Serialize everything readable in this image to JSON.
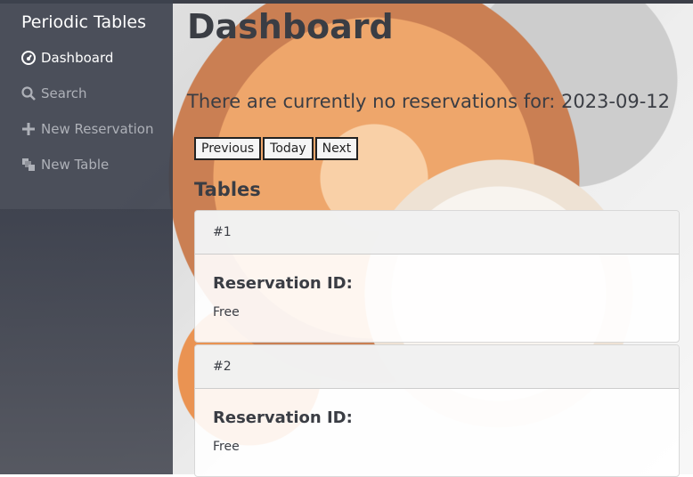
{
  "sidebar": {
    "brand": "Periodic Tables",
    "items": [
      {
        "label": "Dashboard",
        "icon": "dashboard-icon"
      },
      {
        "label": "Search",
        "icon": "search-icon"
      },
      {
        "label": "New Reservation",
        "icon": "plus-icon"
      },
      {
        "label": "New Table",
        "icon": "layers-icon"
      }
    ]
  },
  "main": {
    "title": "Dashboard",
    "reservations_message": "There are currently no reservations for: 2023-09-12",
    "date_controls": {
      "previous": "Previous",
      "today": "Today",
      "next": "Next"
    },
    "tables_heading": "Tables",
    "tables": [
      {
        "name": "#1",
        "reservation_label": "Reservation ID:",
        "status": "Free"
      },
      {
        "name": "#2",
        "reservation_label": "Reservation ID:",
        "status": "Free"
      }
    ]
  },
  "colors": {
    "sidebar_bg": "#3e424e",
    "text_dark": "#3a3d44",
    "nav_inactive": "#aeb1b8",
    "nav_active": "#ffffff"
  }
}
